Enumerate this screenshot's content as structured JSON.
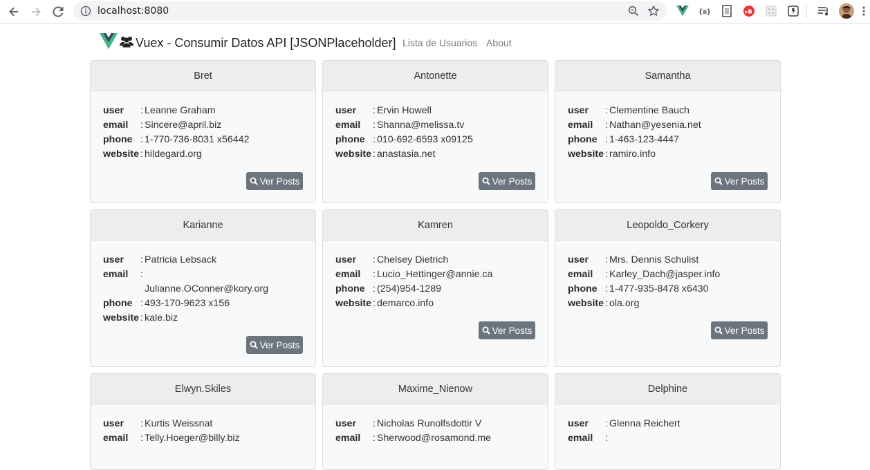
{
  "browser": {
    "url": "localhost:8080",
    "colors": {
      "vue_green": "#41b883",
      "vue_dark": "#35495e",
      "ext_red": "#e53935"
    }
  },
  "app": {
    "title": "Vuex - Consumir Datos API [JSONPlaceholder]",
    "nav_links": [
      "Lista de Usuarios",
      "About"
    ],
    "field_labels": {
      "user": "user",
      "email": "email",
      "phone": "phone",
      "website": "website"
    },
    "colon": ":",
    "button_label": "Ver Posts"
  },
  "users": [
    {
      "username": "Bret",
      "name": "Leanne Graham",
      "email": "Sincere@april.biz",
      "phone": "1-770-736-8031 x56442",
      "website": "hildegard.org"
    },
    {
      "username": "Antonette",
      "name": "Ervin Howell",
      "email": "Shanna@melissa.tv",
      "phone": "010-692-6593 x09125",
      "website": "anastasia.net"
    },
    {
      "username": "Samantha",
      "name": "Clementine Bauch",
      "email": "Nathan@yesenia.net",
      "phone": "1-463-123-4447",
      "website": "ramiro.info"
    },
    {
      "username": "Karianne",
      "name": "Patricia Lebsack",
      "email": "Julianne.OConner@kory.org",
      "phone": "493-170-9623 x156",
      "website": "kale.biz"
    },
    {
      "username": "Kamren",
      "name": "Chelsey Dietrich",
      "email": "Lucio_Hettinger@annie.ca",
      "phone": "(254)954-1289",
      "website": "demarco.info"
    },
    {
      "username": "Leopoldo_Corkery",
      "name": "Mrs. Dennis Schulist",
      "email": "Karley_Dach@jasper.info",
      "phone": "1-477-935-8478 x6430",
      "website": "ola.org"
    },
    {
      "username": "Elwyn.Skiles",
      "name": "Kurtis Weissnat",
      "email": "Telly.Hoeger@billy.biz"
    },
    {
      "username": "Maxime_Nienow",
      "name": "Nicholas Runolfsdottir V",
      "email": "Sherwood@rosamond.me"
    },
    {
      "username": "Delphine",
      "name": "Glenna Reichert",
      "email": ""
    }
  ]
}
